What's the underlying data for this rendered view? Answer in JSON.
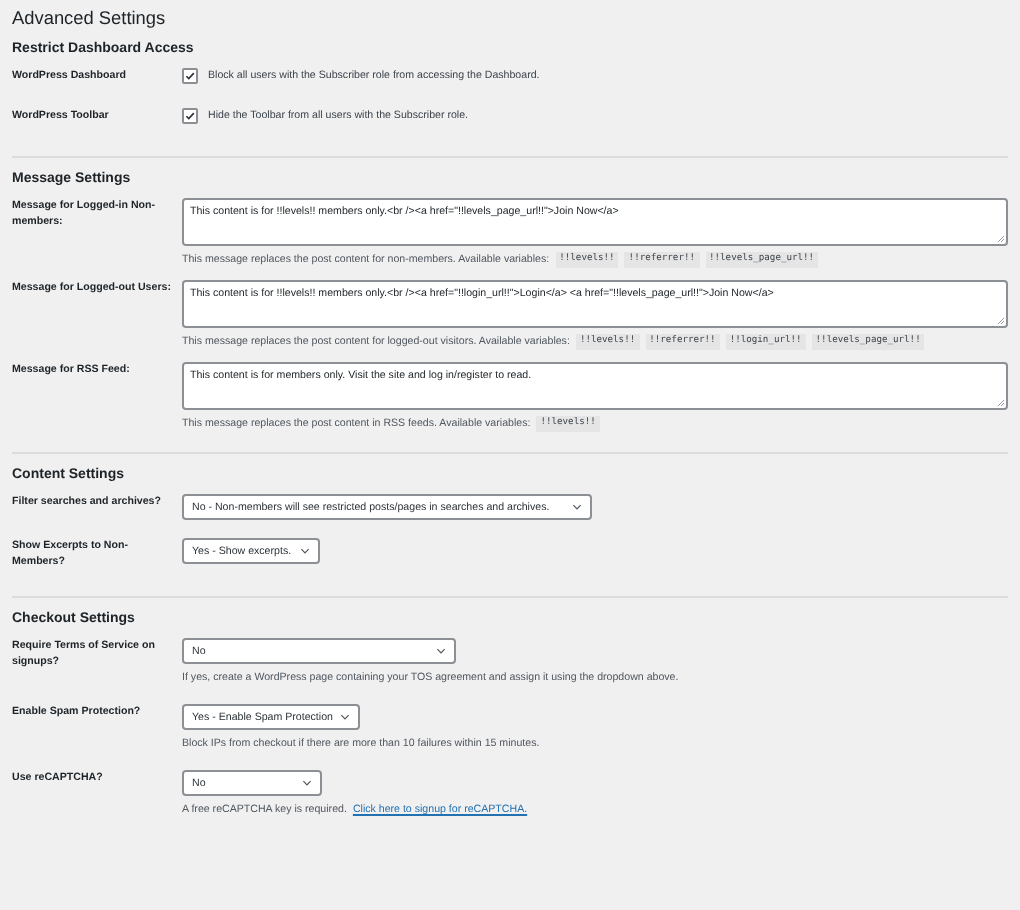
{
  "title": "Advanced Settings",
  "sections": [
    {
      "heading": "Restrict Dashboard Access",
      "rows": [
        {
          "kind": "checkbox",
          "label": "WordPress Dashboard",
          "checked": true,
          "text": "Block all users with the Subscriber role from accessing the Dashboard."
        },
        {
          "kind": "checkbox",
          "label": "WordPress Toolbar",
          "checked": true,
          "text": "Hide the Toolbar from all users with the Subscriber role."
        }
      ]
    },
    {
      "heading": "Message Settings",
      "rows": [
        {
          "kind": "textarea",
          "label": "Message for Logged-in Non-members:",
          "value": "This content is for !!levels!! members only.<br /><a href=\"!!levels_page_url!!\">Join Now</a>",
          "description": "This message replaces the post content for non-members. Available variables:",
          "variables": [
            "!!levels!!",
            "!!referrer!!",
            "!!levels_page_url!!"
          ]
        },
        {
          "kind": "textarea",
          "label": "Message for Logged-out Users:",
          "value": "This content is for !!levels!! members only.<br /><a href=\"!!login_url!!\">Login</a> <a href=\"!!levels_page_url!!\">Join Now</a>",
          "description": "This message replaces the post content for logged-out visitors. Available variables:",
          "variables": [
            "!!levels!!",
            "!!referrer!!",
            "!!login_url!!",
            "!!levels_page_url!!"
          ]
        },
        {
          "kind": "textarea",
          "label": "Message for RSS Feed:",
          "value": "This content is for members only. Visit the site and log in/register to read.",
          "description": "This message replaces the post content in RSS feeds. Available variables:",
          "variables": [
            "!!levels!!"
          ]
        }
      ]
    },
    {
      "heading": "Content Settings",
      "rows": [
        {
          "kind": "select",
          "label": "Filter searches and archives?",
          "value": "No - Non-members will see restricted posts/pages in searches and archives."
        },
        {
          "kind": "select",
          "label": "Show Excerpts to Non-Members?",
          "value": "Yes - Show excerpts."
        }
      ]
    },
    {
      "heading": "Checkout Settings",
      "rows": [
        {
          "kind": "select",
          "label": "Require Terms of Service on signups?",
          "value": "No",
          "description": "If yes, create a WordPress page containing your TOS agreement and assign it using the dropdown above."
        },
        {
          "kind": "select",
          "label": "Enable Spam Protection?",
          "value": "Yes - Enable Spam Protection",
          "description": "Block IPs from checkout if there are more than 10 failures within 15 minutes."
        },
        {
          "kind": "select",
          "label": "Use reCAPTCHA?",
          "value": "No",
          "description": "A free reCAPTCHA key is required.",
          "link": "Click here to signup for reCAPTCHA."
        }
      ]
    }
  ]
}
